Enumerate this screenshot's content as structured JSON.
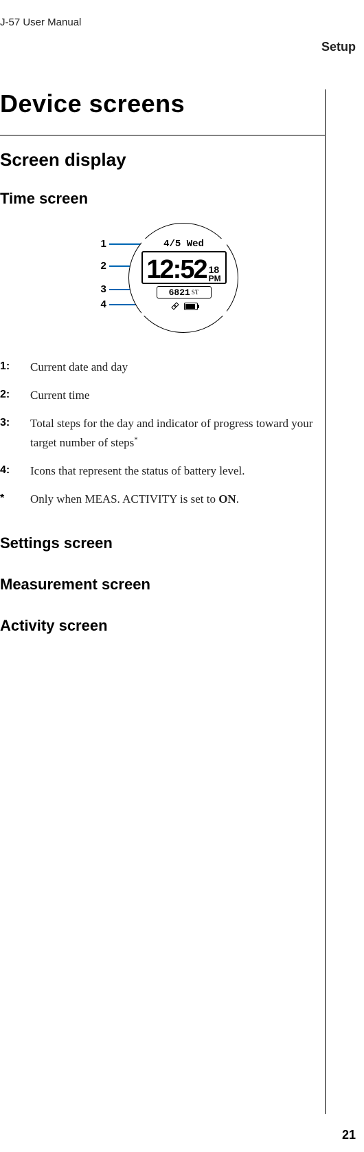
{
  "header": {
    "left": "J-57     User Manual",
    "right": "Setup"
  },
  "title": "Device screens",
  "section1": "Screen display",
  "section2": "Time screen",
  "watch": {
    "date": "4/5 Wed",
    "time_main": "12:52",
    "time_sec": "18",
    "time_pm": "PM",
    "steps": "6821",
    "steps_unit": "ST"
  },
  "callouts": {
    "c1": "1",
    "c2": "2",
    "c3": "3",
    "c4": "4"
  },
  "legend": {
    "items": [
      {
        "num": "1:",
        "text": "Current date and day"
      },
      {
        "num": "2:",
        "text": "Current time"
      },
      {
        "num": "3:",
        "text": "Total steps for the day and indicator of progress toward your target number of steps",
        "sup": "*"
      },
      {
        "num": "4:",
        "text": "Icons that represent the status of battery level."
      }
    ],
    "footnote": {
      "num": "*",
      "pre": "Only when MEAS. ACTIVITY is set to ",
      "bold": "ON",
      "post": "."
    }
  },
  "section3": "Settings screen",
  "section4": "Measurement screen",
  "section5": "Activity screen",
  "pagenum": "21"
}
